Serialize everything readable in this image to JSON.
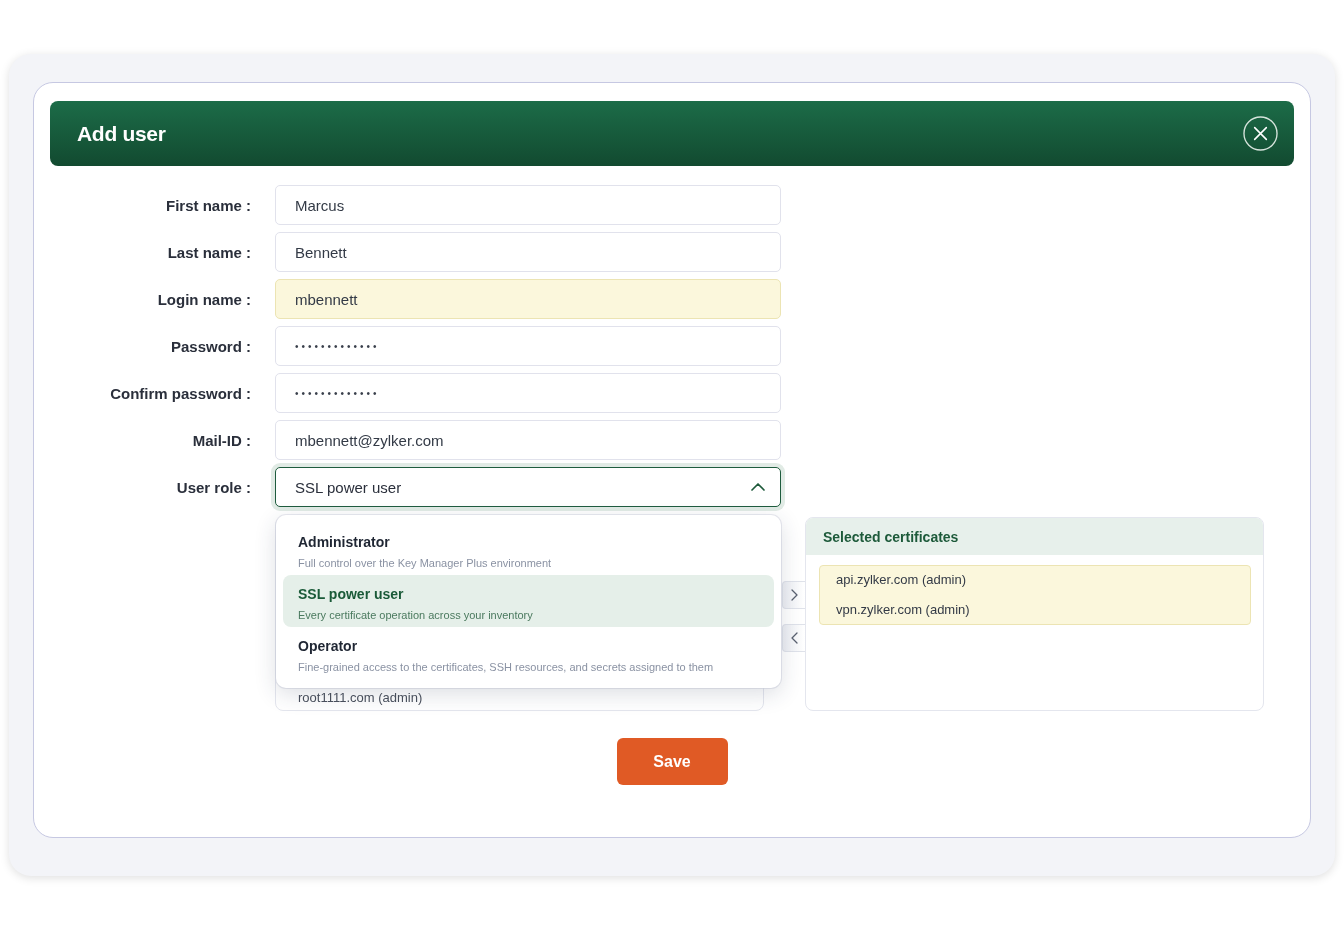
{
  "dialog": {
    "title": "Add user"
  },
  "fields": [
    {
      "label": "First name :",
      "value": "Marcus",
      "kind": "text",
      "autofilled": false
    },
    {
      "label": "Last name :",
      "value": "Bennett",
      "kind": "text",
      "autofilled": false
    },
    {
      "label": "Login name :",
      "value": "mbennett",
      "kind": "text",
      "autofilled": true
    },
    {
      "label": "Password :",
      "value": "•••••••••••••",
      "kind": "password",
      "autofilled": false
    },
    {
      "label": "Confirm password :",
      "value": "•••••••••••••",
      "kind": "password",
      "autofilled": false
    },
    {
      "label": "Mail-ID :",
      "value": "mbennett@zylker.com",
      "kind": "text",
      "autofilled": false
    }
  ],
  "user_role": {
    "label": "User role :",
    "value": "SSL power user",
    "expanded": true,
    "options": [
      {
        "title": "Administrator",
        "description": "Full control over the Key Manager Plus environment",
        "selected": false
      },
      {
        "title": "SSL power user",
        "description": "Every certificate operation across your inventory",
        "selected": true
      },
      {
        "title": "Operator",
        "description": "Fine-grained access to the certificates, SSH resources, and secrets assigned to them",
        "selected": false
      }
    ]
  },
  "available_certificates": {
    "items": [
      "root1111.com (admin)"
    ]
  },
  "selected_certificates": {
    "title": "Selected certificates",
    "items": [
      "api.zylker.com (admin)",
      "vpn.zylker.com (admin)"
    ]
  },
  "save_button": {
    "label": "Save"
  }
}
